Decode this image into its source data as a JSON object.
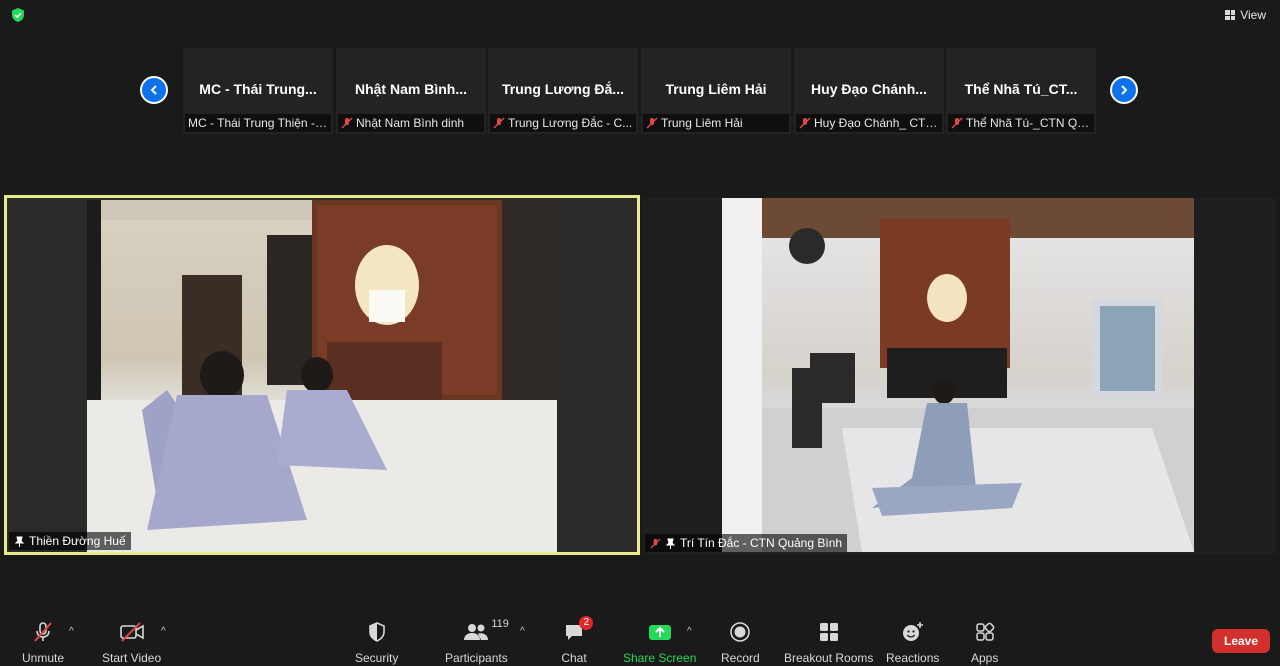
{
  "top_bar": {
    "view_label": "View"
  },
  "participant_strip": {
    "tiles": [
      {
        "title": "MC - Thái Trung...",
        "label": "MC - Thái Trung Thiện - ...",
        "muted": false
      },
      {
        "title": "Nhật Nam Bình...",
        "label": "Nhật Nam Bình dinh",
        "muted": true
      },
      {
        "title": "Trung Lương Đắ...",
        "label": "Trung Lương Đắc - C...",
        "muted": true
      },
      {
        "title": "Trung Liêm Hải",
        "label": "Trung Liêm Hải",
        "muted": true
      },
      {
        "title": "Huy Đạo Chánh...",
        "label": "Huy Đạo Chánh_ CTN...",
        "muted": true
      },
      {
        "title": "Thể Nhã Tú_CT...",
        "label": "Thể Nhã Tú-_CTN Qu...",
        "muted": true
      }
    ]
  },
  "videos": {
    "left": {
      "name": "Thiền Đường Huế"
    },
    "right": {
      "name": "Trí Tín Đắc - CTN Quảng Bình"
    }
  },
  "toolbar": {
    "unmute": "Unmute",
    "start_video": "Start Video",
    "security": "Security",
    "participants": "Participants",
    "participants_count": "119",
    "chat": "Chat",
    "chat_badge": "2",
    "share_screen": "Share Screen",
    "record": "Record",
    "breakout_rooms": "Breakout Rooms",
    "reactions": "Reactions",
    "apps": "Apps",
    "leave": "Leave"
  },
  "colors": {
    "accent": "#0e72ed",
    "share_green": "#23d959",
    "leave_red": "#d32f2f",
    "speaker_border": "#e8ea8f"
  }
}
